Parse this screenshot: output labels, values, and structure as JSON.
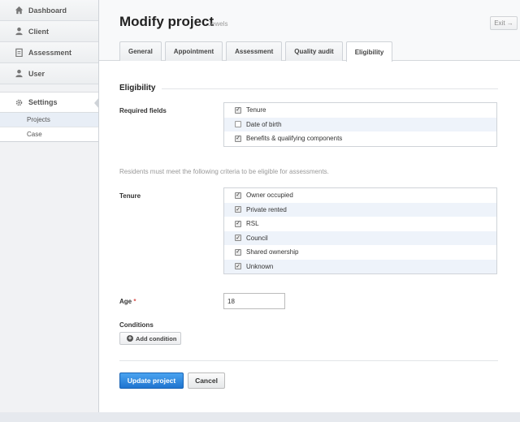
{
  "sidebar": {
    "items": [
      {
        "label": "Dashboard",
        "icon": "home-icon"
      },
      {
        "label": "Client",
        "icon": "person-icon"
      },
      {
        "label": "Assessment",
        "icon": "clipboard-icon"
      },
      {
        "label": "User",
        "icon": "person-icon"
      },
      {
        "label": "Settings",
        "icon": "gear-icon"
      }
    ],
    "subitems": [
      {
        "label": "Projects"
      },
      {
        "label": "Case"
      }
    ]
  },
  "header": {
    "title": "Modify project",
    "subtitle": "Jewels",
    "exit_label": "Exit →"
  },
  "tabs": [
    {
      "label": "General"
    },
    {
      "label": "Appointment"
    },
    {
      "label": "Assessment"
    },
    {
      "label": "Quality audit"
    },
    {
      "label": "Eligibility"
    }
  ],
  "form": {
    "section_title": "Eligibility",
    "required_fields_label": "Required fields",
    "required_fields": [
      {
        "label": "Tenure",
        "checked": true
      },
      {
        "label": "Date of birth",
        "checked": false
      },
      {
        "label": "Benefits & qualifying components",
        "checked": true
      }
    ],
    "hint": "Residents must meet the following criteria to be eligible for assessments.",
    "tenure_label": "Tenure",
    "tenure_options": [
      {
        "label": "Owner occupied",
        "checked": true
      },
      {
        "label": "Private rented",
        "checked": true
      },
      {
        "label": "RSL",
        "checked": true
      },
      {
        "label": "Council",
        "checked": true
      },
      {
        "label": "Shared ownership",
        "checked": true
      },
      {
        "label": "Unknown",
        "checked": true
      }
    ],
    "age_label": "Age",
    "age_required_mark": "*",
    "age_value": "18",
    "conditions_label": "Conditions",
    "add_condition_label": "Add condition",
    "update_label": "Update project",
    "cancel_label": "Cancel"
  },
  "colors": {
    "primary": "#1f74cf",
    "required": "#d9534f"
  }
}
